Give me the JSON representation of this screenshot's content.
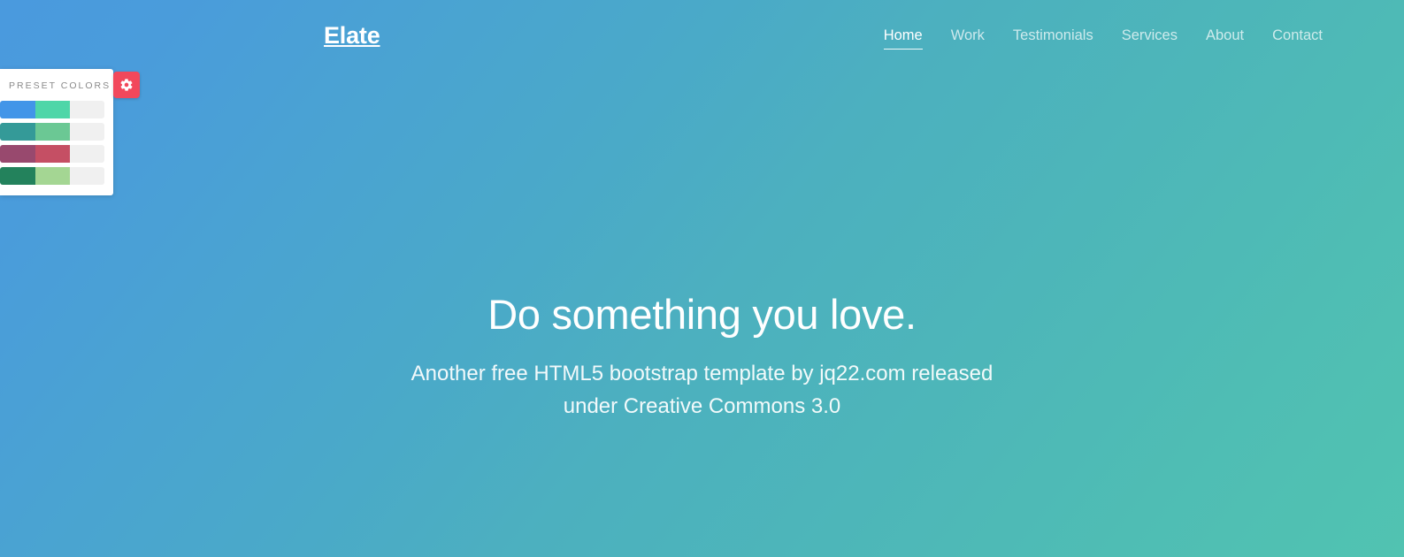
{
  "header": {
    "brand": "Elate",
    "nav": [
      {
        "label": "Home",
        "active": true
      },
      {
        "label": "Work",
        "active": false
      },
      {
        "label": "Testimonials",
        "active": false
      },
      {
        "label": "Services",
        "active": false
      },
      {
        "label": "About",
        "active": false
      },
      {
        "label": "Contact",
        "active": false
      }
    ]
  },
  "preset_panel": {
    "title": "PRESET COLORS",
    "gear_icon": "gear-icon",
    "gear_button_color": "#f2485b",
    "rows": [
      {
        "colors": [
          "#4295e8",
          "#4fd6a8",
          "#f0f0f0"
        ]
      },
      {
        "colors": [
          "#349a98",
          "#6bc894",
          "#f0f0f0"
        ]
      },
      {
        "colors": [
          "#98496e",
          "#c54f64",
          "#f0f0f0"
        ]
      },
      {
        "colors": [
          "#23825c",
          "#a4d693",
          "#f0f0f0"
        ]
      }
    ]
  },
  "hero": {
    "title": "Do something you love.",
    "subtitle": "Another free HTML5 bootstrap template by jq22.com released under Creative Commons 3.0"
  },
  "background": {
    "from": "#4a9ade",
    "to": "#51c3b1"
  }
}
